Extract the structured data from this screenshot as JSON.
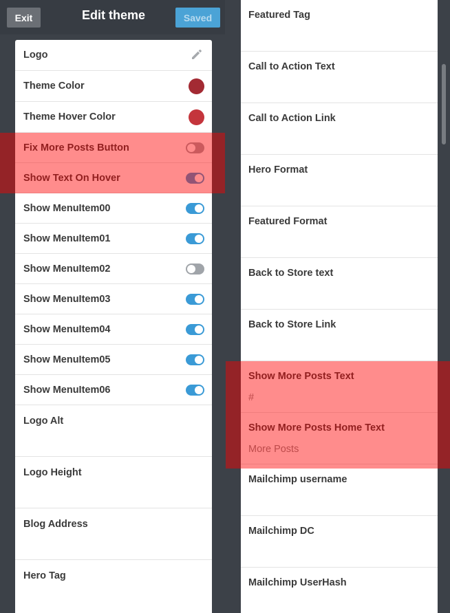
{
  "header": {
    "exit_label": "Exit",
    "title": "Edit theme",
    "saved_label": "Saved"
  },
  "left_list": {
    "logo": {
      "label": "Logo",
      "icon": "pencil-icon"
    },
    "theme_color": {
      "label": "Theme Color",
      "color": "#a32a33"
    },
    "theme_hover_color": {
      "label": "Theme Hover Color",
      "color": "#c4353c"
    },
    "toggles": [
      {
        "label": "Fix More Posts Button",
        "on": false
      },
      {
        "label": "Show Text On Hover",
        "on": true
      },
      {
        "label": "Show MenuItem00",
        "on": true
      },
      {
        "label": "Show MenuItem01",
        "on": true
      },
      {
        "label": "Show MenuItem02",
        "on": false
      },
      {
        "label": "Show MenuItem03",
        "on": true
      },
      {
        "label": "Show MenuItem04",
        "on": true
      },
      {
        "label": "Show MenuItem05",
        "on": true
      },
      {
        "label": "Show MenuItem06",
        "on": true
      }
    ],
    "fields": [
      {
        "label": "Logo Alt"
      },
      {
        "label": "Logo Height"
      },
      {
        "label": "Blog Address"
      },
      {
        "label": "Hero Tag"
      }
    ]
  },
  "right_list": {
    "fields": [
      {
        "label": "Featured Tag",
        "value": ""
      },
      {
        "label": "Call to Action Text",
        "value": ""
      },
      {
        "label": "Call to Action Link",
        "value": ""
      },
      {
        "label": "Hero Format",
        "value": ""
      },
      {
        "label": "Featured Format",
        "value": ""
      },
      {
        "label": "Back to Store text",
        "value": ""
      },
      {
        "label": "Back to Store Link",
        "value": ""
      },
      {
        "label": "Show More Posts Text",
        "value": "#"
      },
      {
        "label": "Show More Posts Home Text",
        "value": "More Posts"
      },
      {
        "label": "Mailchimp username",
        "value": ""
      },
      {
        "label": "Mailchimp DC",
        "value": ""
      },
      {
        "label": "Mailchimp UserHash",
        "value": ""
      }
    ]
  },
  "colors": {
    "toggle_on": "#3a9ad6",
    "toggle_off": "#a0a4a9",
    "highlight": "rgba(255,0,0,0.45)",
    "panel_bg": "#3c4148"
  }
}
